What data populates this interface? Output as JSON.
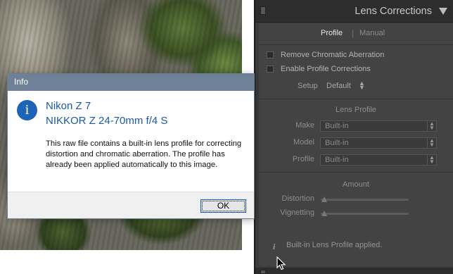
{
  "dialog": {
    "title": "Info",
    "icon": "info-icon",
    "camera": "Nikon Z 7",
    "lens": "NIKKOR Z 24-70mm f/4 S",
    "message": "This raw file contains a built-in lens profile for correcting distortion and chromatic aberration. The profile has already been applied automatically to this image.",
    "ok_label": "OK",
    "accent_color": "#1a59a6",
    "titlebar_color": "#6f8196"
  },
  "panel": {
    "title": "Lens Corrections",
    "tabs": {
      "profile": "Profile",
      "manual": "Manual",
      "active": "Profile"
    },
    "remove_ca_label": "Remove Chromatic Aberration",
    "remove_ca_checked": false,
    "enable_profile_label": "Enable Profile Corrections",
    "enable_profile_checked": false,
    "setup": {
      "label": "Setup",
      "value": "Default"
    },
    "lens_profile": {
      "title": "Lens Profile",
      "make": {
        "label": "Make",
        "value": "Built-in"
      },
      "model": {
        "label": "Model",
        "value": "Built-in"
      },
      "profile": {
        "label": "Profile",
        "value": "Built-in"
      }
    },
    "amount": {
      "title": "Amount",
      "distortion": {
        "label": "Distortion",
        "value": 0
      },
      "vignetting": {
        "label": "Vignetting",
        "value": 0
      }
    },
    "status": {
      "icon": "info-italic-icon",
      "text": "Built-in Lens Profile applied."
    }
  },
  "colors": {
    "panel_bg": "#434343",
    "panel_header": "#2d2d2d"
  }
}
